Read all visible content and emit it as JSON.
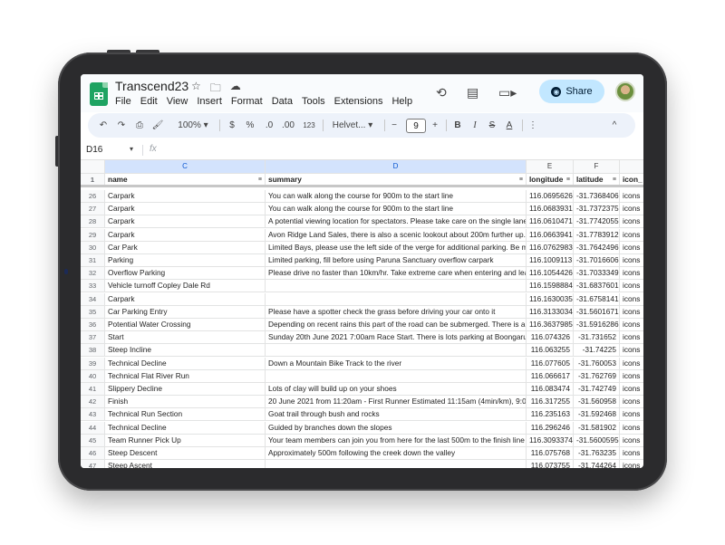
{
  "app": {
    "doc_title": "Transcend23",
    "menu": [
      "File",
      "Edit",
      "View",
      "Insert",
      "Format",
      "Data",
      "Tools",
      "Extensions",
      "Help"
    ],
    "share_label": "Share",
    "icons": [
      "star-icon",
      "move-to-folder-icon",
      "cloud-saved-icon",
      "history-icon",
      "comment-icon",
      "meet-icon",
      "globe-icon",
      "avatar"
    ]
  },
  "toolbar": {
    "zoom": "100%",
    "currency": "$",
    "percent": "%",
    "dec_decrease": ".0",
    "dec_increase": ".00",
    "format_123": "123",
    "font": "Helvet...",
    "font_size": "9",
    "minus": "−",
    "plus": "+",
    "bold": "B",
    "italic": "I",
    "strike": "S",
    "text_color": "A",
    "more": "⋮",
    "collapse": "^"
  },
  "formula_bar": {
    "cell_ref": "D16",
    "fx": "fx"
  },
  "columns": {
    "C": "C",
    "D": "D",
    "E": "E",
    "F": "F"
  },
  "header_row": {
    "num": "1",
    "name": "name",
    "summary": "summary",
    "longitude": "longitude",
    "latitude": "latitude",
    "icon": "icon_"
  },
  "rows": [
    {
      "num": "26",
      "name": "Carpark",
      "summary": "You can walk along the course for 900m to the start line",
      "lon": "116.0695626",
      "lat": "-31.7368406",
      "icon": "icons"
    },
    {
      "num": "27",
      "name": "Carpark",
      "summary": "You can walk along the course for 900m to the start line",
      "lon": "116.0683931",
      "lat": "-31.7372375",
      "icon": "icons"
    },
    {
      "num": "28",
      "name": "Carpark",
      "summary": "A potential viewing location for spectators. Please take care on the single lane e",
      "lon": "116.0610471",
      "lat": "-31.7742055",
      "icon": "icons"
    },
    {
      "num": "29",
      "name": "Carpark",
      "summary": "Avon Ridge Land Sales, there is also a scenic lookout about 200m further up.",
      "lon": "116.0663941",
      "lat": "-31.7783912",
      "icon": "icons"
    },
    {
      "num": "30",
      "name": "Car Park",
      "summary": "Limited Bays, please use the left side of the verge for additional parking. Be mir",
      "lon": "116.0762983",
      "lat": "-31.7642496",
      "icon": "icons"
    },
    {
      "num": "31",
      "name": "Parking",
      "summary": "Limited parking, fill before using Paruna Sanctuary overflow carpark",
      "lon": "116.1009113",
      "lat": "-31.7016606",
      "icon": "icons"
    },
    {
      "num": "32",
      "name": "Overflow Parking",
      "summary": "Please drive no faster than 10km/hr. Take extreme care when entering and leavi",
      "lon": "116.1054426",
      "lat": "-31.7033349",
      "icon": "icons"
    },
    {
      "num": "33",
      "name": "Vehicle turnoff Copley Dale Rd",
      "summary": "",
      "lon": "116.1598884",
      "lat": "-31.6837601",
      "icon": "icons"
    },
    {
      "num": "34",
      "name": "Carpark",
      "summary": "",
      "lon": "116.1630035",
      "lat": "-31.6758141",
      "icon": "icons"
    },
    {
      "num": "35",
      "name": "Car Parking Entry",
      "summary": "Please have a spotter check the grass before driving your car onto it",
      "lon": "116.3133034",
      "lat": "-31.5601671",
      "icon": "icons"
    },
    {
      "num": "36",
      "name": "Potential Water Crossing",
      "summary": "Depending on recent rains this part of the road can be submerged. There is a w",
      "lon": "116.3637985",
      "lat": "-31.5916286",
      "icon": "icons"
    },
    {
      "num": "37",
      "name": "Start",
      "summary": "Sunday 20th June 2021 7:00am Race Start. There is lots parking at Boongarup",
      "lon": "116.074326",
      "lat": "-31.731652",
      "icon": "icons"
    },
    {
      "num": "38",
      "name": "Steep Incline",
      "summary": "",
      "lon": "116.063255",
      "lat": "-31.74225",
      "icon": "icons"
    },
    {
      "num": "39",
      "name": "Technical Decline",
      "summary": "Down a Mountain Bike Track to the river",
      "lon": "116.077605",
      "lat": "-31.760053",
      "icon": "icons"
    },
    {
      "num": "40",
      "name": "Technical Flat River Run",
      "summary": "",
      "lon": "116.066617",
      "lat": "-31.762769",
      "icon": "icons"
    },
    {
      "num": "41",
      "name": "Slippery Decline",
      "summary": "Lots of clay will build up on your shoes",
      "lon": "116.083474",
      "lat": "-31.742749",
      "icon": "icons"
    },
    {
      "num": "42",
      "name": "Finish",
      "summary": "20 June 2021 from 11:20am - First Runner Estimated 11:15am (4min/km), 9:00p",
      "lon": "116.317255",
      "lat": "-31.560958",
      "icon": "icons"
    },
    {
      "num": "43",
      "name": "Technical Run Section",
      "summary": "Goat trail through bush and rocks",
      "lon": "116.235163",
      "lat": "-31.592468",
      "icon": "icons"
    },
    {
      "num": "44",
      "name": "Technical Decline",
      "summary": "Guided by branches down the slopes",
      "lon": "116.296246",
      "lat": "-31.581902",
      "icon": "icons"
    },
    {
      "num": "45",
      "name": "Team Runner Pick Up",
      "summary": "Your team members can join you from here for the last 500m to the finish line",
      "lon": "116.3093374",
      "lat": "-31.5600595",
      "icon": "icons"
    },
    {
      "num": "46",
      "name": "Steep Descent",
      "summary": "Approximately 500m following the creek down the valley",
      "lon": "116.075768",
      "lat": "-31.763235",
      "icon": "icons"
    },
    {
      "num": "47",
      "name": "Steep Ascent",
      "summary": "",
      "lon": "116.073755",
      "lat": "-31.744264",
      "icon": "icons"
    }
  ]
}
